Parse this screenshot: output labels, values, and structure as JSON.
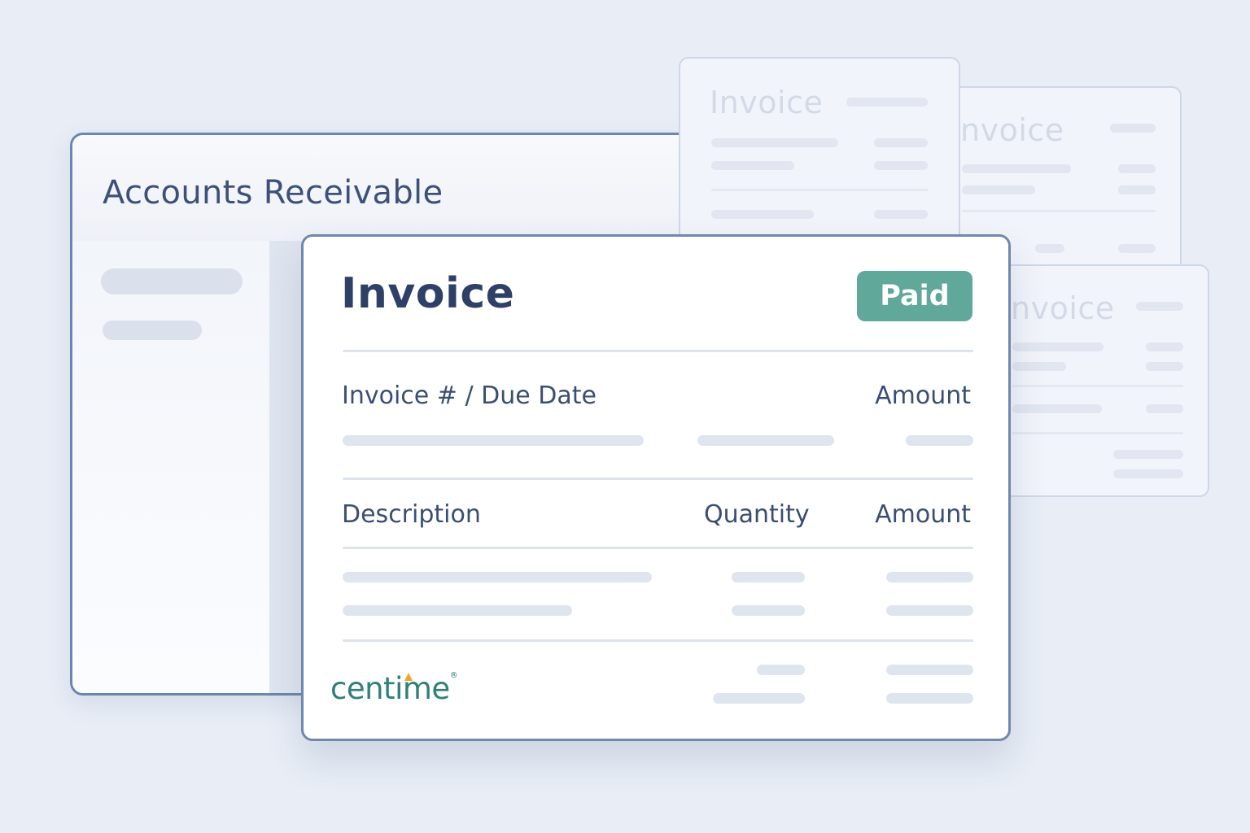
{
  "background_invoices": [
    {
      "title": "Invoice"
    },
    {
      "title": "nvoice"
    },
    {
      "title": "nvoice"
    }
  ],
  "ar_window": {
    "title": "Accounts Receivable"
  },
  "invoice": {
    "title": "Invoice",
    "status": "Paid",
    "header_columns": {
      "left": "Invoice # / Due Date",
      "right": "Amount"
    },
    "line_columns": {
      "description": "Description",
      "quantity": "Quantity",
      "amount": "Amount"
    }
  },
  "brand": {
    "logo_text": "centime",
    "mark": "®"
  },
  "colors": {
    "accent_paid": "#5fa89a",
    "logo": "#2f8079",
    "logo_accent": "#f1a628",
    "window_border": "#6d86ad"
  }
}
